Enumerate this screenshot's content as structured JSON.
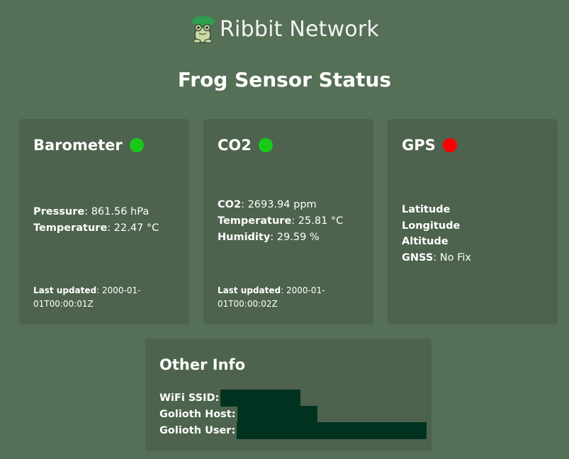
{
  "brand": {
    "name": "Ribbit Network"
  },
  "page_title": "Frog Sensor Status",
  "colors": {
    "ok": "#19c919",
    "error": "#ff0000",
    "background": "#566f57",
    "card": "#4d634d",
    "redaction": "#013220"
  },
  "barometer": {
    "title": "Barometer",
    "status": "ok",
    "pressure_label": "Pressure",
    "pressure_value": "861.56 hPa",
    "temperature_label": "Temperature",
    "temperature_value": "22.47 °C",
    "updated_label": "Last updated",
    "updated_value": "2000-01-01T00:00:01Z"
  },
  "co2": {
    "title": "CO2",
    "status": "ok",
    "co2_label": "CO2",
    "co2_value": "2693.94 ppm",
    "temperature_label": "Temperature",
    "temperature_value": "25.81 °C",
    "humidity_label": "Humidity",
    "humidity_value": "29.59 %",
    "updated_label": "Last updated",
    "updated_value": "2000-01-01T00:00:02Z"
  },
  "gps": {
    "title": "GPS",
    "status": "error",
    "latitude_label": "Latitude",
    "longitude_label": "Longitude",
    "altitude_label": "Altitude",
    "gnss_label": "GNSS",
    "gnss_value": "No Fix"
  },
  "other": {
    "title": "Other Info",
    "wifi_label": "WiFi SSID:",
    "host_label": "Golioth Host:",
    "user_label": "Golioth User:"
  }
}
